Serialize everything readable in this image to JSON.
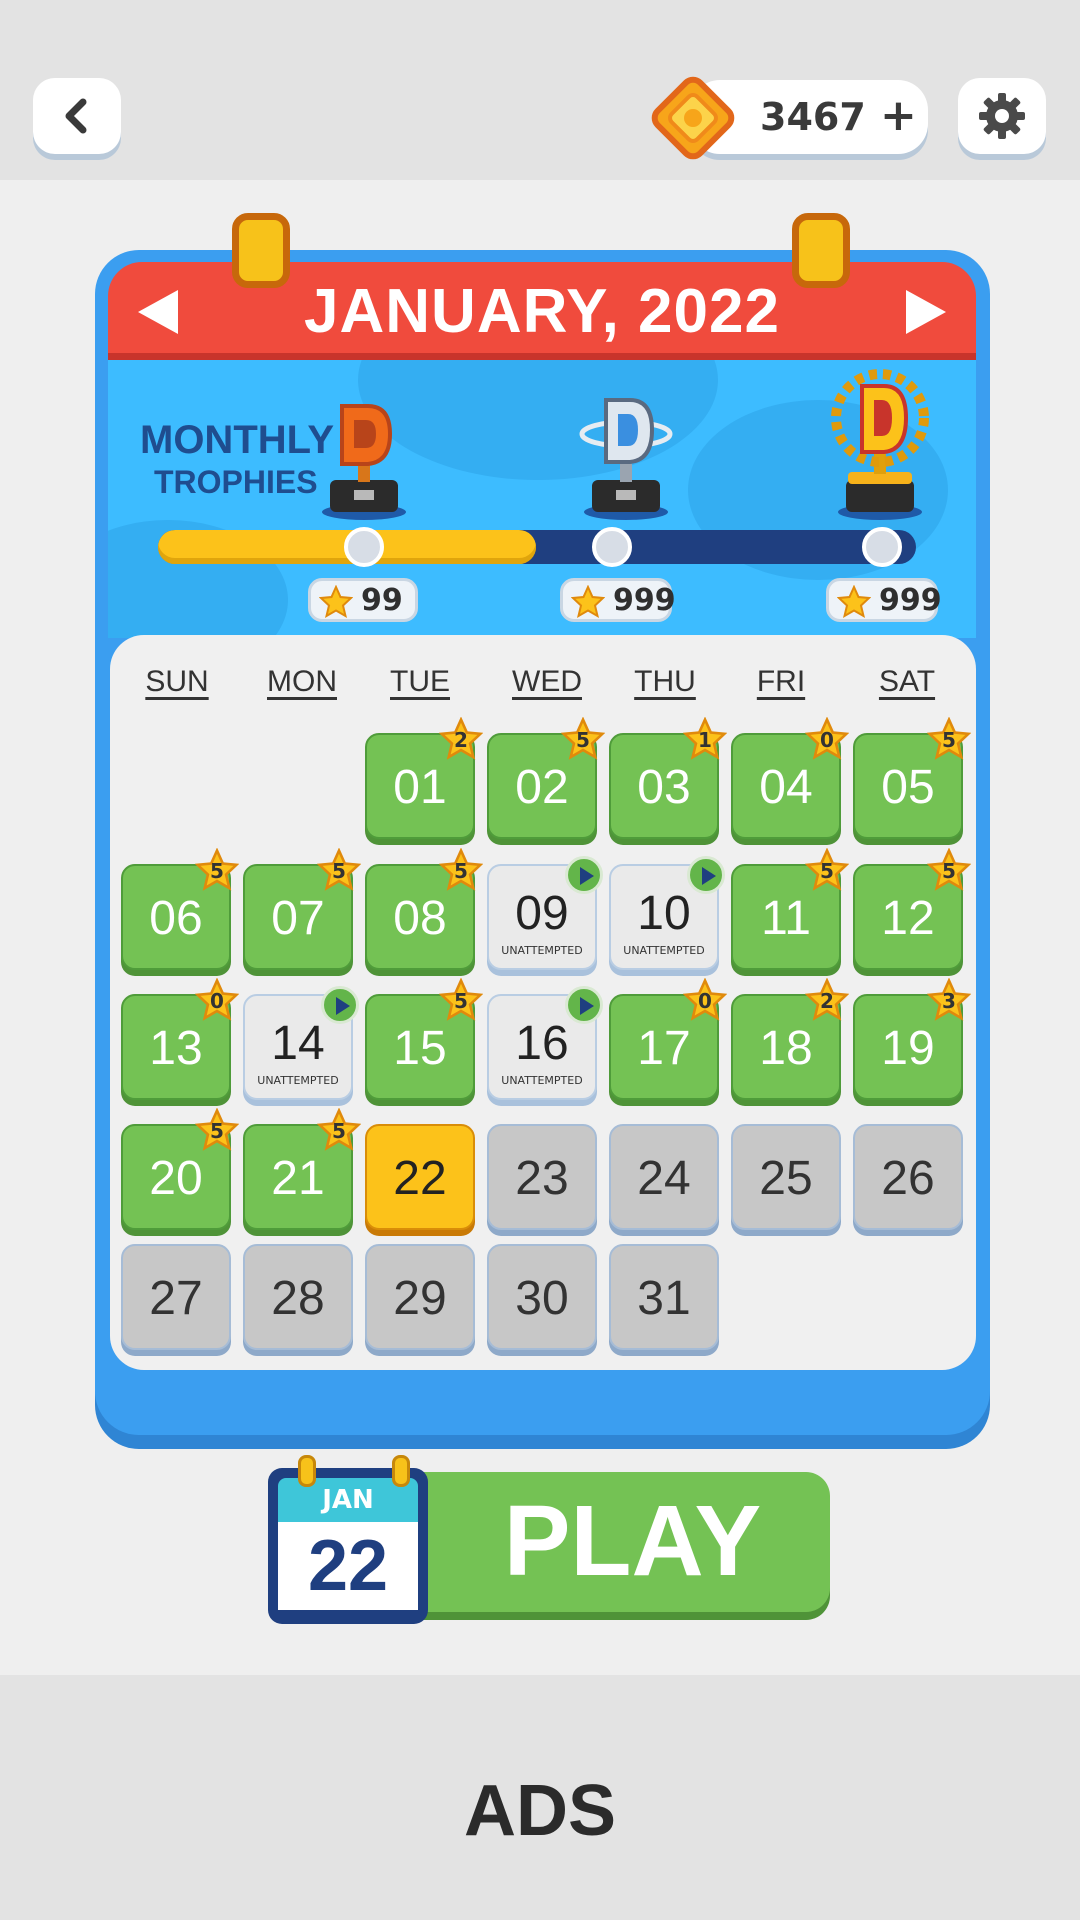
{
  "header": {
    "coins": "3467",
    "plus": "+"
  },
  "calendar": {
    "month_title": "JANUARY, 2022",
    "trophies_line1": "MONTHLY",
    "trophies_line2": "TROPHIES",
    "progress_fraction": 0.5,
    "trophy_costs": [
      "99",
      "999",
      "999"
    ],
    "weekdays": [
      "SUN",
      "MON",
      "TUE",
      "WED",
      "THU",
      "FRI",
      "SAT"
    ],
    "unattempted_label": "UNATTEMPTED",
    "days": [
      {
        "day": "01",
        "state": "done",
        "stars": "2"
      },
      {
        "day": "02",
        "state": "done",
        "stars": "5"
      },
      {
        "day": "03",
        "state": "done",
        "stars": "1"
      },
      {
        "day": "04",
        "state": "done",
        "stars": "0"
      },
      {
        "day": "05",
        "state": "done",
        "stars": "5"
      },
      {
        "day": "06",
        "state": "done",
        "stars": "5"
      },
      {
        "day": "07",
        "state": "done",
        "stars": "5"
      },
      {
        "day": "08",
        "state": "done",
        "stars": "5"
      },
      {
        "day": "09",
        "state": "unattempted"
      },
      {
        "day": "10",
        "state": "unattempted"
      },
      {
        "day": "11",
        "state": "done",
        "stars": "5"
      },
      {
        "day": "12",
        "state": "done",
        "stars": "5"
      },
      {
        "day": "13",
        "state": "done",
        "stars": "0"
      },
      {
        "day": "14",
        "state": "unattempted"
      },
      {
        "day": "15",
        "state": "done",
        "stars": "5"
      },
      {
        "day": "16",
        "state": "unattempted"
      },
      {
        "day": "17",
        "state": "done",
        "stars": "0"
      },
      {
        "day": "18",
        "state": "done",
        "stars": "2"
      },
      {
        "day": "19",
        "state": "done",
        "stars": "3"
      },
      {
        "day": "20",
        "state": "done",
        "stars": "5"
      },
      {
        "day": "21",
        "state": "done",
        "stars": "5"
      },
      {
        "day": "22",
        "state": "today"
      },
      {
        "day": "23",
        "state": "future"
      },
      {
        "day": "24",
        "state": "future"
      },
      {
        "day": "25",
        "state": "future"
      },
      {
        "day": "26",
        "state": "future"
      },
      {
        "day": "27",
        "state": "future"
      },
      {
        "day": "28",
        "state": "future"
      },
      {
        "day": "29",
        "state": "future"
      },
      {
        "day": "30",
        "state": "future"
      },
      {
        "day": "31",
        "state": "future"
      }
    ]
  },
  "play": {
    "mini_month": "JAN",
    "mini_day": "22",
    "label": "PLAY"
  },
  "ads": {
    "label": "ADS"
  },
  "colors": {
    "done": "#74c254",
    "today": "#fcc21a",
    "future": "#c7c7c7",
    "header_red": "#f04b3d",
    "panel_blue": "#3b9ef0"
  },
  "icons": [
    "back-chevron-icon",
    "diamond-coin-icon",
    "gear-icon",
    "star-icon",
    "play-triangle-icon",
    "trophy-icon"
  ]
}
